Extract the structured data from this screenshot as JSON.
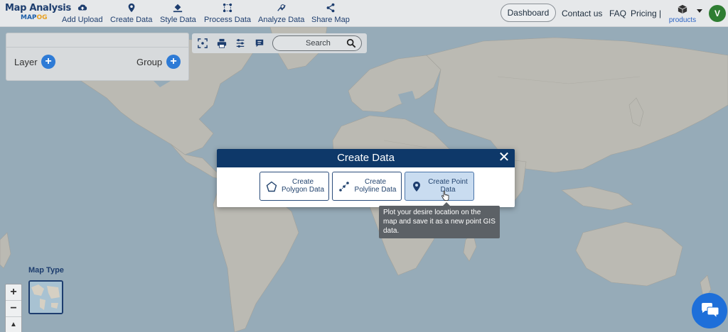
{
  "app": {
    "logo_line1": "Map Analysis",
    "logo_line2a": "MAP",
    "logo_line2b": "OG"
  },
  "toolbar": {
    "add_upload": "Add Upload",
    "create_data": "Create Data",
    "style_data": "Style Data",
    "process_data": "Process Data",
    "analyze_data": "Analyze Data",
    "share_map": "Share Map"
  },
  "nav": {
    "dashboard": "Dashboard",
    "contact": "Contact us",
    "faq": "FAQ",
    "pricing": "Pricing |",
    "products": "products",
    "avatar_initial": "V"
  },
  "layer_panel": {
    "layer_label": "Layer",
    "group_label": "Group"
  },
  "map_tools": {
    "search_placeholder": "Search"
  },
  "modal": {
    "title": "Create Data",
    "close": "✕",
    "options": [
      {
        "line1": "Create",
        "line2": "Polygon Data",
        "icon": "polygon-icon"
      },
      {
        "line1": "Create",
        "line2": "Polyline Data",
        "icon": "polyline-icon"
      },
      {
        "line1": "Create Point",
        "line2": "Data",
        "icon": "map-pin-icon"
      }
    ]
  },
  "tooltip": {
    "text": "Plot your desire location on the map and save it as a new point GIS data."
  },
  "map_type": {
    "label": "Map Type"
  },
  "zoom": {
    "in": "+",
    "out": "−",
    "compass": "▲"
  },
  "colors": {
    "brand_dark": "#0e3869",
    "accent_blue": "#2e7bd6",
    "avatar_green": "#2e7d32",
    "chat_blue": "#1e6fd9"
  }
}
